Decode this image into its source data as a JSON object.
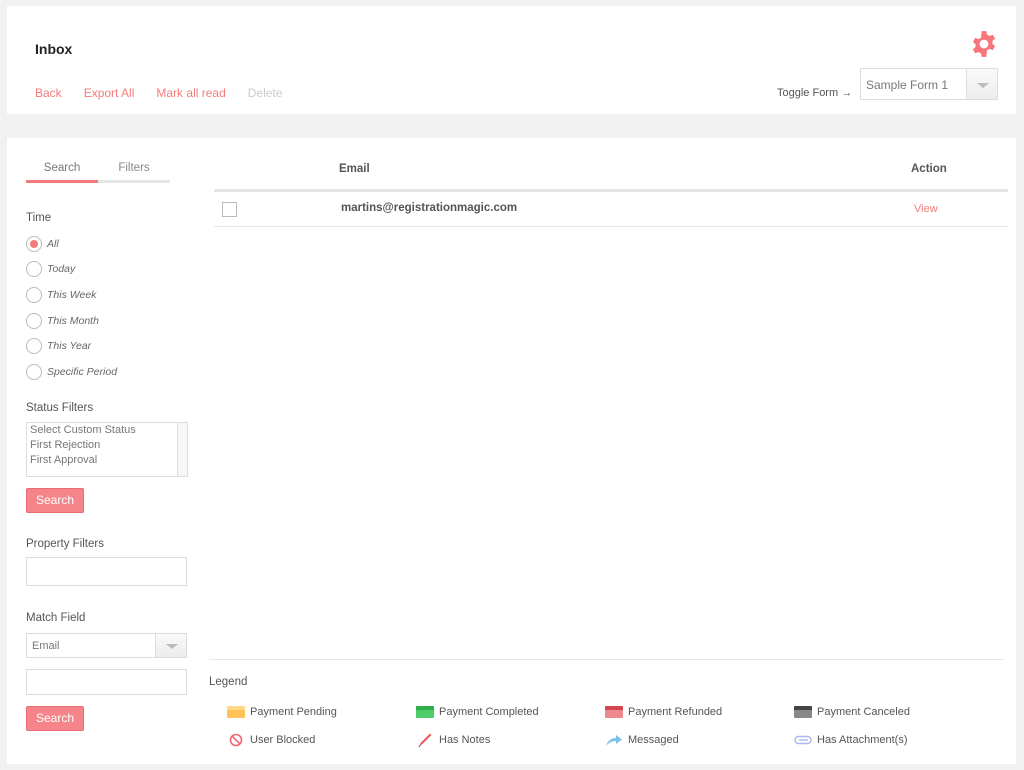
{
  "header": {
    "title": "Inbox",
    "links": [
      {
        "label": "Back",
        "enabled": true
      },
      {
        "label": "Export All",
        "enabled": true
      },
      {
        "label": "Mark all read",
        "enabled": true
      },
      {
        "label": "Delete",
        "enabled": false
      }
    ],
    "settings_icon": "gear-icon",
    "toggle_form_label": "Toggle Form →",
    "form_select_value": "Sample Form 1"
  },
  "sidebar": {
    "tabs": [
      {
        "label": "Search",
        "active": true
      },
      {
        "label": "Filters",
        "active": false
      }
    ],
    "time_label": "Time",
    "time_options": [
      {
        "label": "All",
        "checked": true
      },
      {
        "label": "Today",
        "checked": false
      },
      {
        "label": "This Week",
        "checked": false
      },
      {
        "label": "This Month",
        "checked": false
      },
      {
        "label": "This Year",
        "checked": false
      },
      {
        "label": "Specific Period",
        "checked": false
      }
    ],
    "status_filters_label": "Status Filters",
    "status_options": [
      "Select Custom Status",
      "First Rejection",
      "First Approval"
    ],
    "search_button": "Search",
    "property_filters_label": "Property Filters",
    "property_filters_value": "",
    "match_field_label": "Match Field",
    "match_field_value": "Email",
    "match_value": "",
    "search_button_2": "Search"
  },
  "table": {
    "columns": {
      "email": "Email",
      "action": "Action"
    },
    "rows": [
      {
        "email": "martins@registrationmagic.com",
        "action": "View",
        "checked": false
      }
    ]
  },
  "legend": {
    "title": "Legend",
    "items": [
      {
        "label": "Payment Pending",
        "icon": "payment-pending-swatch",
        "color": "#ffc35a"
      },
      {
        "label": "Payment Completed",
        "icon": "payment-completed-swatch",
        "color": "#4fcc6a"
      },
      {
        "label": "Payment Refunded",
        "icon": "payment-refunded-swatch",
        "color": "#e06a72"
      },
      {
        "label": "Payment Canceled",
        "icon": "payment-canceled-swatch",
        "color": "#6d6d6d"
      },
      {
        "label": "User Blocked",
        "icon": "blocked-icon",
        "color": "#f0656f"
      },
      {
        "label": "Has Notes",
        "icon": "pencil-icon",
        "color": "#ee5a5a"
      },
      {
        "label": "Messaged",
        "icon": "reply-arrow-icon",
        "color": "#7ec0e8"
      },
      {
        "label": "Has Attachment(s)",
        "icon": "paperclip-icon",
        "color": "#a9b8f0"
      }
    ]
  },
  "colors": {
    "accent": "#f27c7c",
    "button": "#f5858a"
  }
}
